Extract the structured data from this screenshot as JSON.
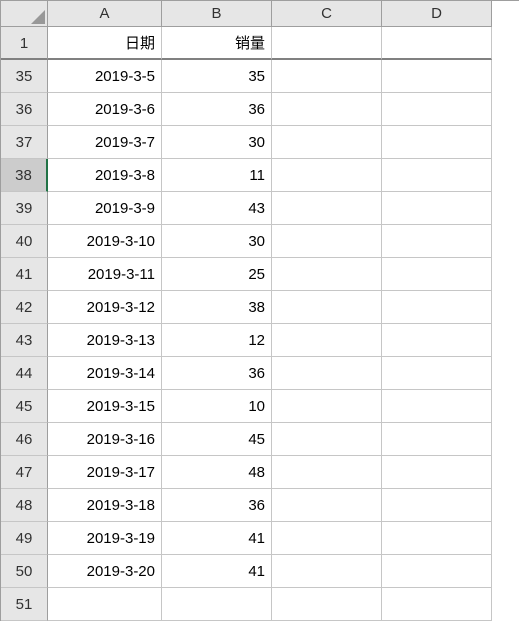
{
  "columns": [
    "A",
    "B",
    "C",
    "D"
  ],
  "headerRow": {
    "rowNum": "1",
    "cells": [
      "日期",
      "销量",
      "",
      ""
    ]
  },
  "selectedRow": 38,
  "dataRows": [
    {
      "rowNum": "35",
      "cells": [
        "2019-3-5",
        "35",
        "",
        ""
      ]
    },
    {
      "rowNum": "36",
      "cells": [
        "2019-3-6",
        "36",
        "",
        ""
      ]
    },
    {
      "rowNum": "37",
      "cells": [
        "2019-3-7",
        "30",
        "",
        ""
      ]
    },
    {
      "rowNum": "38",
      "cells": [
        "2019-3-8",
        "11",
        "",
        ""
      ]
    },
    {
      "rowNum": "39",
      "cells": [
        "2019-3-9",
        "43",
        "",
        ""
      ]
    },
    {
      "rowNum": "40",
      "cells": [
        "2019-3-10",
        "30",
        "",
        ""
      ]
    },
    {
      "rowNum": "41",
      "cells": [
        "2019-3-11",
        "25",
        "",
        ""
      ]
    },
    {
      "rowNum": "42",
      "cells": [
        "2019-3-12",
        "38",
        "",
        ""
      ]
    },
    {
      "rowNum": "43",
      "cells": [
        "2019-3-13",
        "12",
        "",
        ""
      ]
    },
    {
      "rowNum": "44",
      "cells": [
        "2019-3-14",
        "36",
        "",
        ""
      ]
    },
    {
      "rowNum": "45",
      "cells": [
        "2019-3-15",
        "10",
        "",
        ""
      ]
    },
    {
      "rowNum": "46",
      "cells": [
        "2019-3-16",
        "45",
        "",
        ""
      ]
    },
    {
      "rowNum": "47",
      "cells": [
        "2019-3-17",
        "48",
        "",
        ""
      ]
    },
    {
      "rowNum": "48",
      "cells": [
        "2019-3-18",
        "36",
        "",
        ""
      ]
    },
    {
      "rowNum": "49",
      "cells": [
        "2019-3-19",
        "41",
        "",
        ""
      ]
    },
    {
      "rowNum": "50",
      "cells": [
        "2019-3-20",
        "41",
        "",
        ""
      ]
    },
    {
      "rowNum": "51",
      "cells": [
        "",
        "",
        "",
        ""
      ]
    }
  ],
  "chart_data": {
    "type": "table",
    "columns": [
      "日期",
      "销量"
    ],
    "rows": [
      [
        "2019-3-5",
        35
      ],
      [
        "2019-3-6",
        36
      ],
      [
        "2019-3-7",
        30
      ],
      [
        "2019-3-8",
        11
      ],
      [
        "2019-3-9",
        43
      ],
      [
        "2019-3-10",
        30
      ],
      [
        "2019-3-11",
        25
      ],
      [
        "2019-3-12",
        38
      ],
      [
        "2019-3-13",
        12
      ],
      [
        "2019-3-14",
        36
      ],
      [
        "2019-3-15",
        10
      ],
      [
        "2019-3-16",
        45
      ],
      [
        "2019-3-17",
        48
      ],
      [
        "2019-3-18",
        36
      ],
      [
        "2019-3-19",
        41
      ],
      [
        "2019-3-20",
        41
      ]
    ]
  }
}
